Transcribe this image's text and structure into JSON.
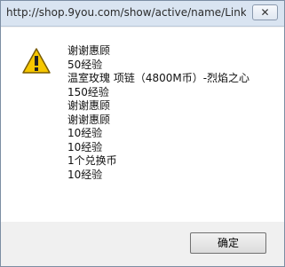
{
  "window": {
    "title": "http://shop.9you.com/show/active/name/Link...",
    "close_label": "✕"
  },
  "dialog": {
    "icon": "warning-icon",
    "messages": [
      "谢谢惠顾",
      "50经验",
      "温室玫瑰 项链（4800M币）-烈焰之心",
      "150经验",
      "谢谢惠顾",
      "谢谢惠顾",
      "10经验",
      "10经验",
      "1个兑换币",
      "10经验"
    ],
    "ok_label": "确定"
  }
}
